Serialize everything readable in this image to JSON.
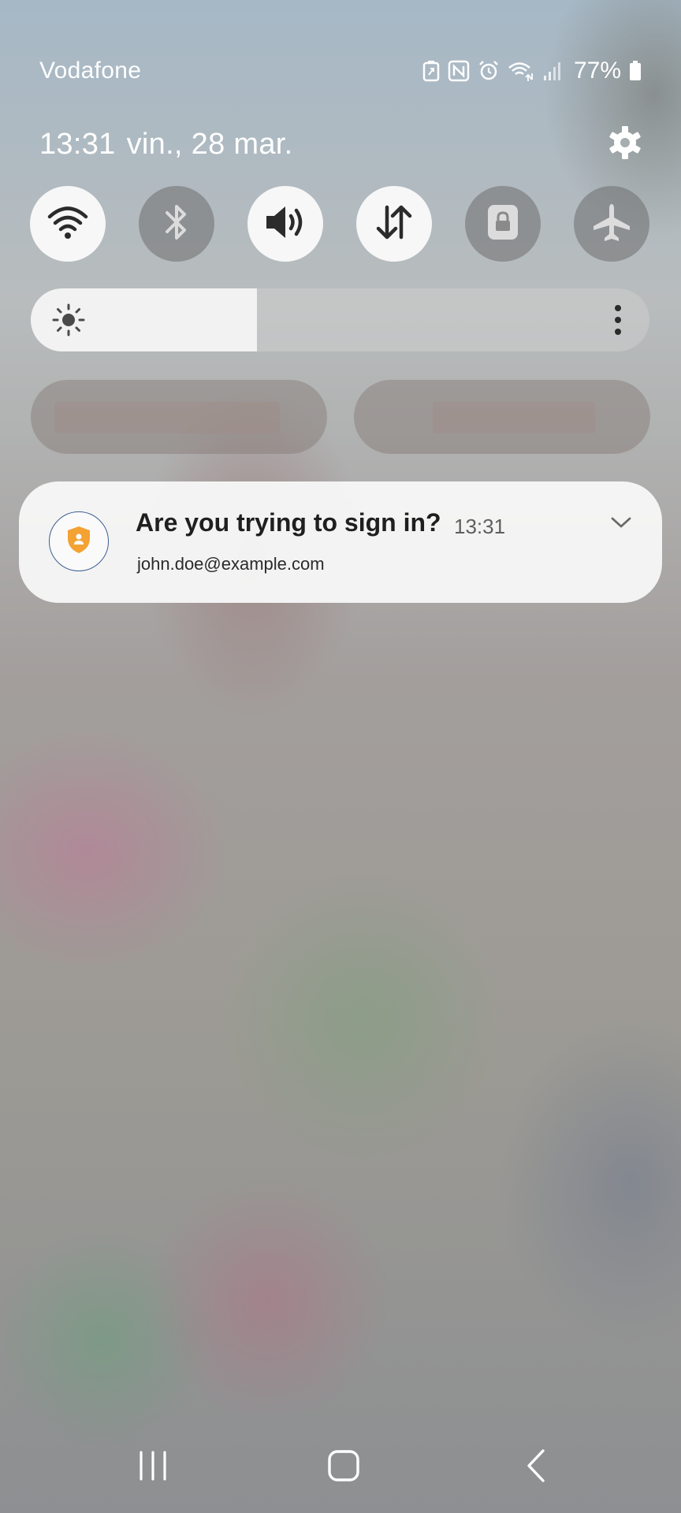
{
  "status_bar": {
    "carrier": "Vodafone",
    "battery_percent": "77%",
    "icons": [
      "battery-saver-icon",
      "nfc-icon",
      "alarm-icon",
      "wifi-data-icon",
      "signal-icon",
      "battery-icon"
    ]
  },
  "header": {
    "time": "13:31",
    "date": "vin., 28 mar."
  },
  "quick_toggles": [
    {
      "name": "wifi",
      "icon": "wifi-icon",
      "state": "on"
    },
    {
      "name": "bluetooth",
      "icon": "bluetooth-icon",
      "state": "off"
    },
    {
      "name": "sound",
      "icon": "sound-icon",
      "state": "on"
    },
    {
      "name": "mobile-data",
      "icon": "mobile-data-icon",
      "state": "on"
    },
    {
      "name": "rotation-lock",
      "icon": "lock-icon",
      "state": "off"
    },
    {
      "name": "airplane-mode",
      "icon": "airplane-icon",
      "state": "off"
    }
  ],
  "brightness": {
    "level": 0.365
  },
  "notification": {
    "title": "Are you trying to sign in?",
    "time": "13:31",
    "body": "john.doe@example.com",
    "icon": "shield-person-icon",
    "accent_color": "#f3a233"
  },
  "colors": {
    "toggle_on": "#f7f7f7",
    "toggle_icon_on": "#2b2b2b",
    "toggle_icon_off": "#dcdcdc",
    "notification_icon_border": "#3d5d92"
  }
}
